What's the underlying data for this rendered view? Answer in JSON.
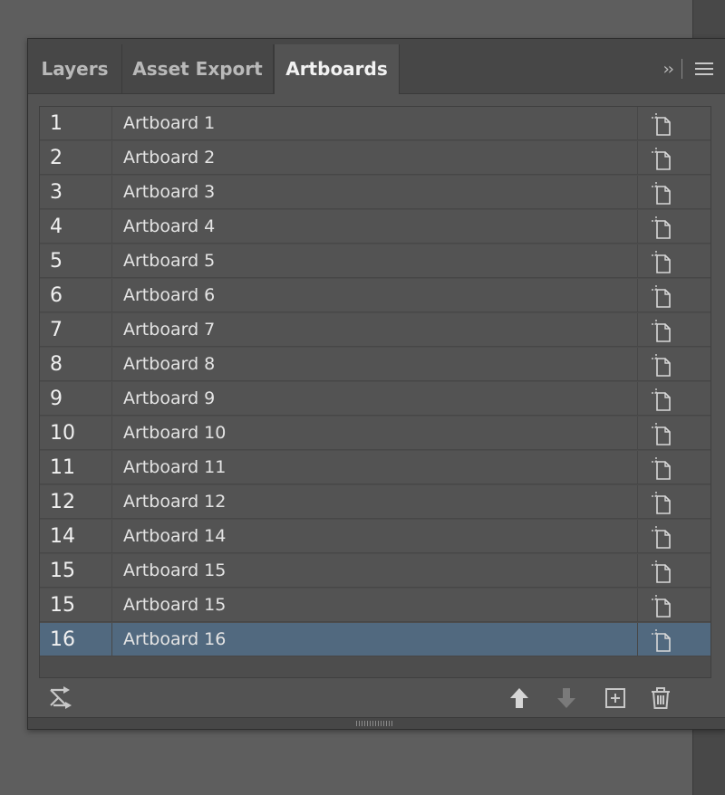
{
  "tabs": [
    {
      "label": "Layers",
      "active": false
    },
    {
      "label": "Asset Export",
      "active": false
    },
    {
      "label": "Artboards",
      "active": true
    }
  ],
  "tabbar_controls": {
    "collapse_glyph": "››",
    "menu_icon": "hamburger-menu-icon"
  },
  "artboards": [
    {
      "number": "1",
      "name": "Artboard 1",
      "selected": false
    },
    {
      "number": "2",
      "name": "Artboard 2",
      "selected": false
    },
    {
      "number": "3",
      "name": "Artboard 3",
      "selected": false
    },
    {
      "number": "4",
      "name": "Artboard 4",
      "selected": false
    },
    {
      "number": "5",
      "name": "Artboard 5",
      "selected": false
    },
    {
      "number": "6",
      "name": "Artboard 6",
      "selected": false
    },
    {
      "number": "7",
      "name": "Artboard 7",
      "selected": false
    },
    {
      "number": "8",
      "name": "Artboard 8",
      "selected": false
    },
    {
      "number": "9",
      "name": "Artboard 9",
      "selected": false
    },
    {
      "number": "10",
      "name": "Artboard 10",
      "selected": false
    },
    {
      "number": "11",
      "name": "Artboard 11",
      "selected": false
    },
    {
      "number": "12",
      "name": "Artboard 12",
      "selected": false
    },
    {
      "number": "14",
      "name": "Artboard 14",
      "selected": false
    },
    {
      "number": "15",
      "name": "Artboard 15",
      "selected": false
    },
    {
      "number": "15",
      "name": "Artboard 15",
      "selected": false
    },
    {
      "number": "16",
      "name": "Artboard 16",
      "selected": true
    }
  ],
  "bottom_toolbar": {
    "icons": [
      "rearrange-artboards-icon",
      "move-up-icon",
      "move-down-icon",
      "new-artboard-icon",
      "delete-artboard-icon"
    ]
  },
  "colors": {
    "panel_bg": "#535353",
    "tab_bar_bg": "#474747",
    "selected_row": "#51697f",
    "workspace_bg": "#5e5e5e"
  }
}
